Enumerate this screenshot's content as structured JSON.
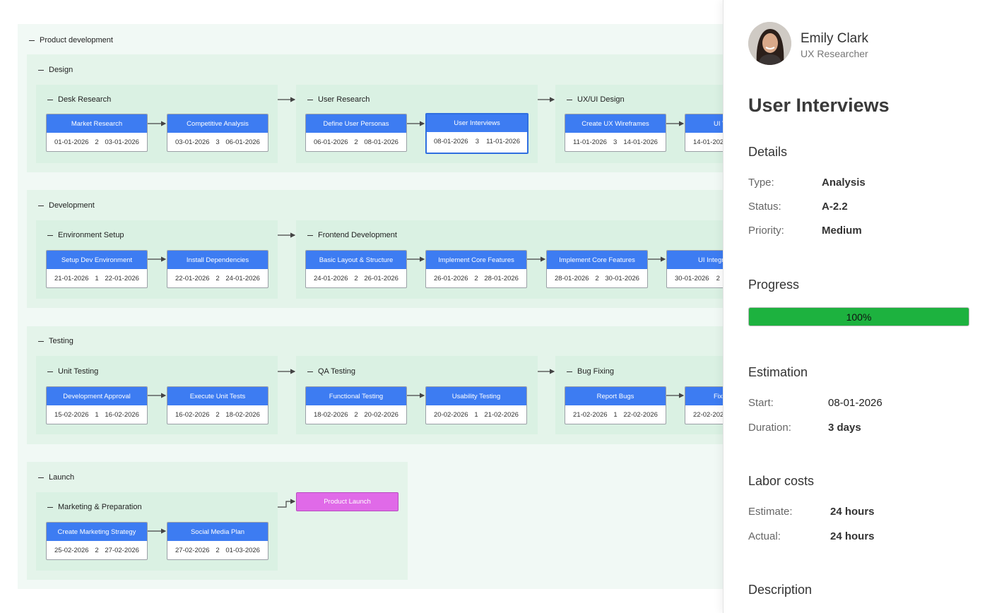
{
  "project": {
    "title": "Product development"
  },
  "phases": [
    {
      "title": "Design",
      "groups": [
        {
          "title": "Desk Research",
          "tasks": [
            {
              "name": "Market Research",
              "start": "01-01-2026",
              "duration": "2",
              "end": "03-01-2026"
            },
            {
              "name": "Competitive Analysis",
              "start": "03-01-2026",
              "duration": "3",
              "end": "06-01-2026"
            }
          ]
        },
        {
          "title": "User Research",
          "tasks": [
            {
              "name": "Define User Personas",
              "start": "06-01-2026",
              "duration": "2",
              "end": "08-01-2026"
            },
            {
              "name": "User Interviews",
              "start": "08-01-2026",
              "duration": "3",
              "end": "11-01-2026"
            }
          ]
        },
        {
          "title": "UX/UI Design",
          "tasks": [
            {
              "name": "Create UX Wireframes",
              "start": "11-01-2026",
              "duration": "3",
              "end": "14-01-2026"
            },
            {
              "name": "UI V",
              "start": "14-01-202",
              "duration": "",
              "end": ""
            }
          ]
        }
      ]
    },
    {
      "title": "Development",
      "groups": [
        {
          "title": "Environment Setup",
          "tasks": [
            {
              "name": "Setup Dev Environment",
              "start": "21-01-2026",
              "duration": "1",
              "end": "22-01-2026"
            },
            {
              "name": "Install Dependencies",
              "start": "22-01-2026",
              "duration": "2",
              "end": "24-01-2026"
            }
          ]
        },
        {
          "title": "Frontend Development",
          "tasks": [
            {
              "name": "Basic Layout & Structure",
              "start": "24-01-2026",
              "duration": "2",
              "end": "26-01-2026"
            },
            {
              "name": "Implement Core Features",
              "start": "26-01-2026",
              "duration": "2",
              "end": "28-01-2026"
            },
            {
              "name": "Implement Core Features",
              "start": "28-01-2026",
              "duration": "2",
              "end": "30-01-2026"
            },
            {
              "name": "UI Integr",
              "start": "30-01-2026",
              "duration": "2",
              "end": ""
            }
          ]
        }
      ]
    },
    {
      "title": "Testing",
      "groups": [
        {
          "title": "Unit Testing",
          "tasks": [
            {
              "name": "Development Approval",
              "start": "15-02-2026",
              "duration": "1",
              "end": "16-02-2026"
            },
            {
              "name": "Execute Unit Tests",
              "start": "16-02-2026",
              "duration": "2",
              "end": "18-02-2026"
            }
          ]
        },
        {
          "title": "QA Testing",
          "tasks": [
            {
              "name": "Functional Testing",
              "start": "18-02-2026",
              "duration": "2",
              "end": "20-02-2026"
            },
            {
              "name": "Usability Testing",
              "start": "20-02-2026",
              "duration": "1",
              "end": "21-02-2026"
            }
          ]
        },
        {
          "title": "Bug Fixing",
          "tasks": [
            {
              "name": "Report Bugs",
              "start": "21-02-2026",
              "duration": "1",
              "end": "22-02-2026"
            },
            {
              "name": "Fix",
              "start": "22-02-202",
              "duration": "",
              "end": ""
            }
          ]
        }
      ]
    },
    {
      "title": "Launch",
      "groups": [
        {
          "title": "Marketing & Preparation",
          "tasks": [
            {
              "name": "Create Marketing Strategy",
              "start": "25-02-2026",
              "duration": "2",
              "end": "27-02-2026"
            },
            {
              "name": "Social Media Plan",
              "start": "27-02-2026",
              "duration": "2",
              "end": "01-03-2026"
            }
          ]
        }
      ],
      "milestone": "Product Launch"
    }
  ],
  "panel": {
    "user": {
      "name": "Emily Clark",
      "role": "UX Researcher",
      "avatar_icon": "user-avatar-photo"
    },
    "task_title": "User Interviews",
    "details": {
      "heading": "Details",
      "type_label": "Type:",
      "type_value": "Analysis",
      "status_label": "Status:",
      "status_value": "A-2.2",
      "priority_label": "Priority:",
      "priority_value": "Medium"
    },
    "progress": {
      "heading": "Progress",
      "value": 1.0,
      "text": "100%",
      "color": "#1db23f"
    },
    "estimation": {
      "heading": "Estimation",
      "start_label": "Start:",
      "start_value": "08-01-2026",
      "duration_label": "Duration:",
      "duration_value": "3 days"
    },
    "labor": {
      "heading": "Labor costs",
      "estimate_label": "Estimate:",
      "estimate_value": "24 hours",
      "actual_label": "Actual:",
      "actual_value": "24 hours"
    },
    "description": {
      "heading": "Description"
    }
  },
  "colors": {
    "task_header": "#3d7cf2",
    "milestone": "#e06ae8",
    "selected_border": "#2f6fe0"
  }
}
